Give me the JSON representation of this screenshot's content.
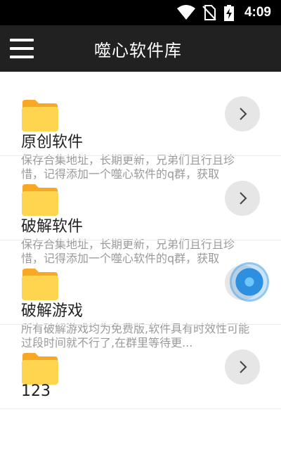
{
  "status_bar": {
    "time": "4:09",
    "icons": [
      "wifi-icon",
      "no-sim-icon",
      "battery-charging-icon"
    ]
  },
  "app_bar": {
    "title": "噬心软件库",
    "menu_icon": "menu-icon"
  },
  "items": [
    {
      "title": "原创软件",
      "description": "保存合集地址，长期更新，兄弟们且行且珍惜，记得添加一个噬心软件的q群，获取"
    },
    {
      "title": "破解软件",
      "description": "保存合集地址，长期更新，兄弟们且行且珍惜，记得添加一个噬心软件的q群，获取"
    },
    {
      "title": "破解游戏",
      "description": "所有破解游戏均为免费版,软件具有时效性可能过段时间就不行了,在群里等待更..."
    },
    {
      "title": "123",
      "description": ""
    }
  ],
  "colors": {
    "status_bar": "#000000",
    "app_bar": "#212121",
    "folder": "#FFD54F",
    "folder_tab": "#F9A825",
    "arrow_button": "#E6E6E6",
    "touch_indicator": "#2D8FE0"
  }
}
